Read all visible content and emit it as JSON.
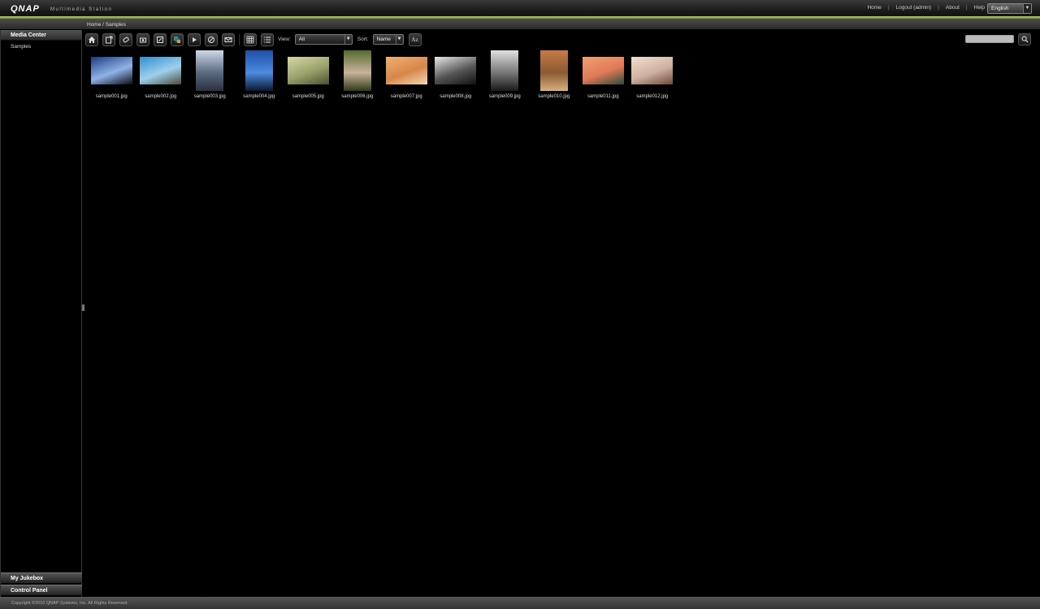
{
  "header": {
    "logo": "QNAP",
    "subtitle": "Multimedia Station",
    "links": [
      "Home",
      "Logout (admin)",
      "About",
      "Help"
    ],
    "language": "English"
  },
  "breadcrumb": "Home / Samples",
  "sidebar": {
    "header": "Media Center",
    "items": [
      {
        "label": "Samples"
      }
    ],
    "bottom": [
      "My Jukebox",
      "Control Panel"
    ]
  },
  "toolbar": {
    "view_label": "View:",
    "view_value": "All",
    "sort_label": "Sort:",
    "sort_value": "Name",
    "sort_order_label": "Az"
  },
  "thumbnails": [
    {
      "name": "sample001.jpg",
      "colors": [
        "#1b3a7e",
        "#8fb3e8",
        "#0a0a12"
      ],
      "orientation": "landscape"
    },
    {
      "name": "sample002.jpg",
      "colors": [
        "#2f8fd0",
        "#9fd0ec",
        "#4a4a3a"
      ],
      "orientation": "landscape"
    },
    {
      "name": "sample003.jpg",
      "colors": [
        "#cfd9e8",
        "#5a6a80",
        "#2a3040"
      ],
      "orientation": "portrait"
    },
    {
      "name": "sample004.jpg",
      "colors": [
        "#1d4fa8",
        "#4e8be0",
        "#0b1730"
      ],
      "orientation": "portrait"
    },
    {
      "name": "sample005.jpg",
      "colors": [
        "#d6d8a8",
        "#9aa06a",
        "#4c4e30"
      ],
      "orientation": "landscape"
    },
    {
      "name": "sample006.jpg",
      "colors": [
        "#566a30",
        "#c7b49a",
        "#2e3a18"
      ],
      "orientation": "portrait"
    },
    {
      "name": "sample007.jpg",
      "colors": [
        "#f0b070",
        "#d6874a",
        "#f5d9b0"
      ],
      "orientation": "landscape"
    },
    {
      "name": "sample008.jpg",
      "colors": [
        "#e8e8e8",
        "#555555",
        "#111111"
      ],
      "orientation": "landscape"
    },
    {
      "name": "sample009.jpg",
      "colors": [
        "#e0e0e0",
        "#777777",
        "#1a1a1a"
      ],
      "orientation": "portrait"
    },
    {
      "name": "sample010.jpg",
      "colors": [
        "#c77a4a",
        "#8a5a30",
        "#d8b080"
      ],
      "orientation": "portrait"
    },
    {
      "name": "sample011.jpg",
      "colors": [
        "#f0a070",
        "#e07a58",
        "#2a4a3a"
      ],
      "orientation": "landscape"
    },
    {
      "name": "sample012.jpg",
      "colors": [
        "#f0e0d0",
        "#d0b0a0",
        "#6a4a3a"
      ],
      "orientation": "landscape"
    }
  ],
  "footer": "Copyright ©2010 QNAP Systems, Inc. All Rights Reserved."
}
